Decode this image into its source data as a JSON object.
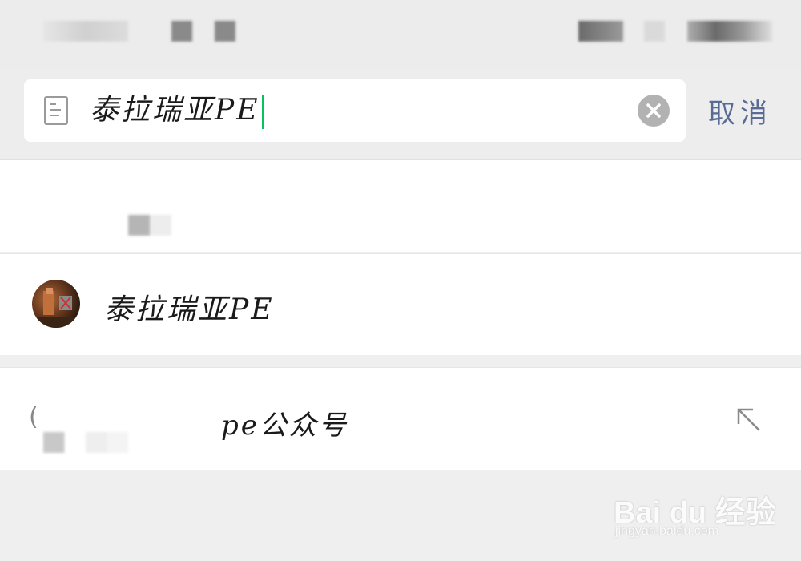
{
  "search": {
    "query": "泰拉瑞亚PE",
    "cancel_label": "取消",
    "icon_left": "document-icon",
    "icon_clear": "clear-icon"
  },
  "results": {
    "contact": {
      "name": "泰拉瑞亚PE",
      "icon": "avatar"
    }
  },
  "suggestion": {
    "prefix": "(",
    "text": "pe公众号",
    "icon": "fill-arrow-icon"
  },
  "watermark": {
    "logo": "Bai du 经验",
    "url": "jingyan.baidu.com"
  },
  "colors": {
    "accent": "#07c160",
    "link": "#576b95",
    "background": "#efefef"
  }
}
